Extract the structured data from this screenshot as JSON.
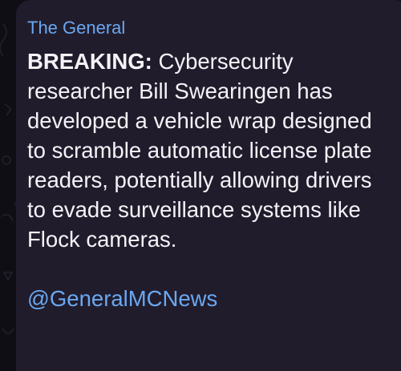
{
  "message": {
    "sender_name": "The General",
    "lead_label": "BREAKING:",
    "body_text": " Cybersecurity researcher Bill Swearingen has developed a vehicle wrap designed to scramble automatic license plate readers, potentially allowing drivers to evade surveillance systems like Flock cameras.",
    "link_handle": "@GeneralMCNews"
  },
  "colors": {
    "bubble_background": "#211c2c",
    "sender_color": "#6aa8f0",
    "text_color": "#f4f3f7",
    "link_color": "#6aa8f0"
  }
}
